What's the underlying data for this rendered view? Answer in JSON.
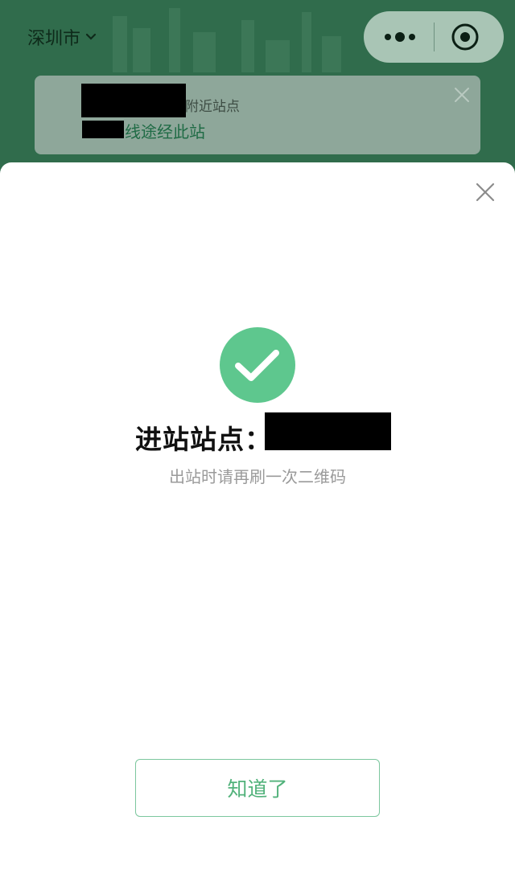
{
  "header": {
    "city": "深圳市",
    "icons": [
      "chevron-down-icon",
      "more-icon",
      "mini-program-close-icon"
    ]
  },
  "notice": {
    "line1_suffix": "附近站点",
    "line2_suffix": "线途经此站"
  },
  "modal": {
    "title_prefix": "进站站点：",
    "subtitle": "出站时请再刷一次二维码",
    "confirm_label": "知道了",
    "icons": [
      "success-check-icon",
      "close-icon"
    ]
  },
  "colors": {
    "header_green": "#306c4c",
    "accent_green": "#5ec78e",
    "button_text": "#52b27b"
  }
}
